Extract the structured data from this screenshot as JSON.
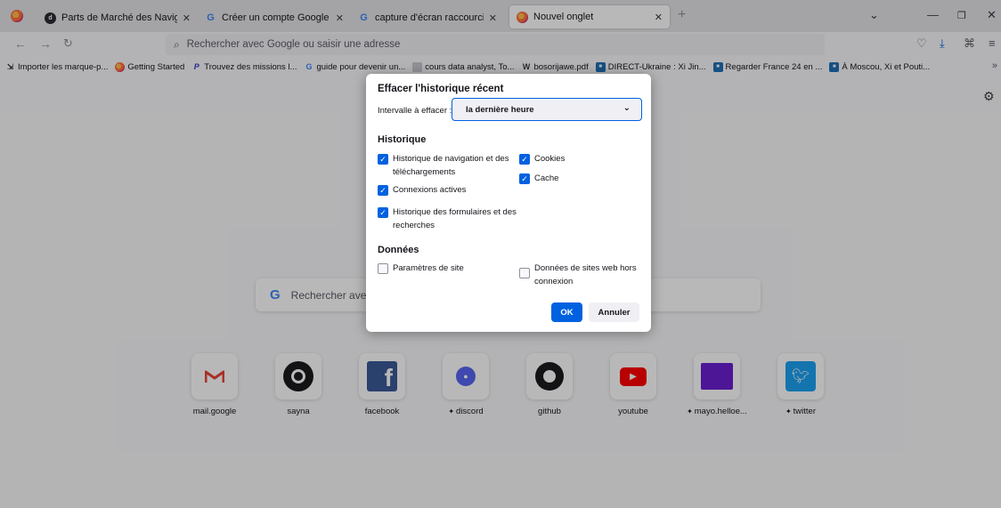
{
  "tabs": [
    {
      "title": "Parts de Marché des Navigateur",
      "favicon": "parts-favicon"
    },
    {
      "title": "Créer un compte Google - Aide",
      "favicon": "google-favicon"
    },
    {
      "title": "capture d'écran raccourci clavie",
      "favicon": "google-favicon"
    },
    {
      "title": "Nouvel onglet",
      "favicon": "firefox-favicon",
      "active": true
    }
  ],
  "urlbar": {
    "placeholder": "Rechercher avec Google ou saisir une adresse"
  },
  "bookmarks": [
    {
      "label": "Importer les marque-p...",
      "icon": "import-icon"
    },
    {
      "label": "Getting Started",
      "icon": "firefox-icon"
    },
    {
      "label": "Trouvez des missions l...",
      "icon": "p-icon"
    },
    {
      "label": "guide pour devenir un...",
      "icon": "google-icon"
    },
    {
      "label": "cours data analyst, To...",
      "icon": "page-icon"
    },
    {
      "label": "bosorijawe.pdf",
      "icon": "w-icon"
    },
    {
      "label": "DIRECT-Ukraine : Xi Jin...",
      "icon": "news-icon"
    },
    {
      "label": "Regarder France 24 en ...",
      "icon": "news-icon"
    },
    {
      "label": "À Moscou, Xi et Pouti...",
      "icon": "news-icon"
    }
  ],
  "search": {
    "text": "Rechercher avec"
  },
  "top_sites": [
    {
      "label": "mail.google",
      "pinned": false
    },
    {
      "label": "sayna",
      "pinned": false
    },
    {
      "label": "facebook",
      "pinned": false
    },
    {
      "label": "discord",
      "pinned": true
    },
    {
      "label": "github",
      "pinned": false
    },
    {
      "label": "youtube",
      "pinned": false
    },
    {
      "label": "mayo.helloe...",
      "pinned": true
    },
    {
      "label": "twitter",
      "pinned": true
    }
  ],
  "dialog": {
    "title": "Effacer l'historique récent",
    "range_label": "Intervalle à effacer :",
    "range_value": "la dernière heure",
    "history_heading": "Historique",
    "history_items": [
      {
        "label": "Historique de navigation et des téléchargements",
        "checked": true
      },
      {
        "label": "Connexions actives",
        "checked": true
      },
      {
        "label": "Historique des formulaires et des recherches",
        "checked": true
      },
      {
        "label": "Cookies",
        "checked": true
      },
      {
        "label": "Cache",
        "checked": true
      }
    ],
    "data_heading": "Données",
    "data_items": [
      {
        "label": "Paramètres de site",
        "checked": false
      },
      {
        "label": "Données de sites web hors connexion",
        "checked": false
      }
    ],
    "ok_label": "OK",
    "cancel_label": "Annuler"
  },
  "colors": {
    "accent": "#0061e0",
    "tabstrip": "#e4e3e8",
    "page": "#f9f9fb"
  }
}
